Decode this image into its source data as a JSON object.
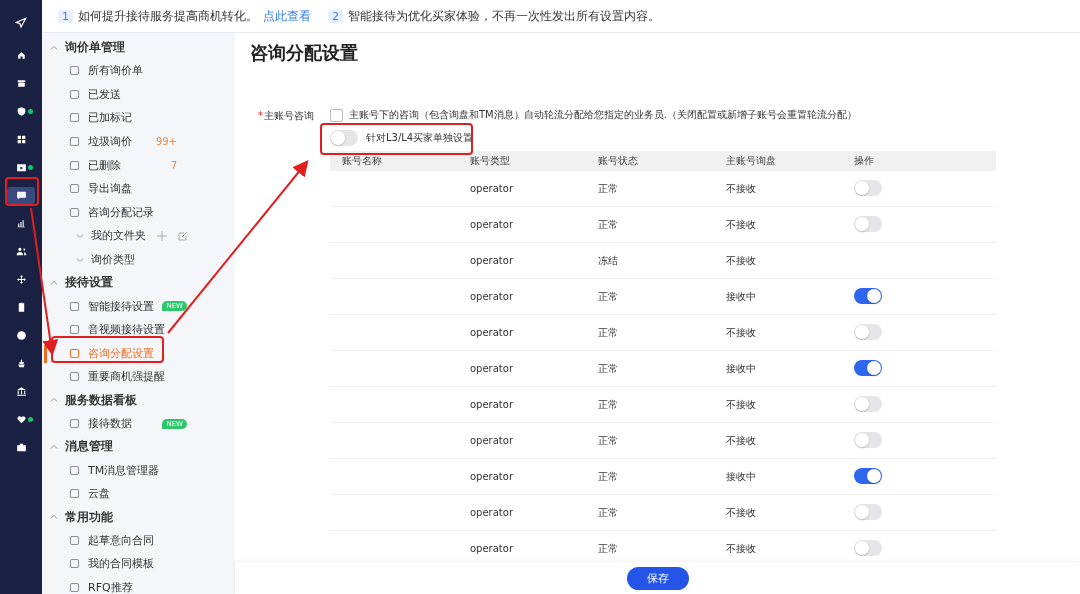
{
  "rail": [
    {
      "selected": false,
      "dot": false
    },
    {
      "selected": false,
      "dot": false
    },
    {
      "selected": false,
      "dot": true
    },
    {
      "selected": false,
      "dot": false
    },
    {
      "selected": false,
      "dot": true
    },
    {
      "selected": true,
      "dot": false
    },
    {
      "selected": false,
      "dot": false
    },
    {
      "selected": false,
      "dot": false
    },
    {
      "selected": false,
      "dot": false
    },
    {
      "selected": false,
      "dot": false
    },
    {
      "selected": false,
      "dot": false
    },
    {
      "selected": false,
      "dot": false
    },
    {
      "selected": false,
      "dot": false
    },
    {
      "selected": false,
      "dot": true
    },
    {
      "selected": false,
      "dot": false
    }
  ],
  "notices": [
    {
      "number": "1",
      "text": "如何提升接待服务提高商机转化。",
      "link": "点此查看"
    },
    {
      "number": "2",
      "text": "智能接待为优化买家体验，不再一次性发出所有设置内容。"
    }
  ],
  "sidebar": [
    {
      "title": "询价单管理",
      "expanded": true,
      "items": [
        {
          "kind": "item",
          "label": "所有询价单",
          "selected": false
        },
        {
          "kind": "item",
          "label": "已发送",
          "selected": false
        },
        {
          "kind": "item",
          "label": "已加标记",
          "selected": false
        },
        {
          "kind": "item",
          "label": "垃圾询价",
          "count": "99+",
          "selected": false
        },
        {
          "kind": "item",
          "label": "已删除",
          "count": "7",
          "selected": false
        },
        {
          "kind": "item",
          "label": "导出询盘",
          "selected": false
        },
        {
          "kind": "item",
          "label": "咨询分配记录",
          "selected": false
        },
        {
          "kind": "folder",
          "label": "我的文件夹",
          "actions": true,
          "selected": false
        },
        {
          "kind": "folder",
          "label": "询价类型",
          "selected": false
        }
      ]
    },
    {
      "title": "接待设置",
      "expanded": true,
      "items": [
        {
          "kind": "item",
          "label": "智能接待设置",
          "tag": "NEW",
          "selected": false
        },
        {
          "kind": "item",
          "label": "音视频接待设置",
          "selected": false
        },
        {
          "kind": "item",
          "label": "咨询分配设置",
          "selected": true
        },
        {
          "kind": "item",
          "label": "重要商机强提醒",
          "selected": false
        }
      ]
    },
    {
      "title": "服务数据看板",
      "expanded": true,
      "items": [
        {
          "kind": "item",
          "label": "接待数据",
          "tag": "NEW",
          "selected": false
        }
      ]
    },
    {
      "title": "消息管理",
      "expanded": true,
      "items": [
        {
          "kind": "item",
          "label": "TM消息管理器",
          "selected": false
        },
        {
          "kind": "item",
          "label": "云盘",
          "selected": false
        }
      ]
    },
    {
      "title": "常用功能",
      "expanded": true,
      "items": [
        {
          "kind": "item",
          "label": "起草意向合同",
          "selected": false
        },
        {
          "kind": "item",
          "label": "我的合同模板",
          "selected": false
        },
        {
          "kind": "item",
          "label": "RFQ推荐",
          "selected": false
        }
      ]
    }
  ],
  "page_title": "咨询分配设置",
  "form": {
    "label": "主账号咨询",
    "required_mark": "*",
    "checkbox": {
      "label": "主账号下的咨询（包含询盘和TM消息）自动轮流分配给您指定的业务员.（关闭配置或新增子账号会重置轮流分配）",
      "checked": false
    },
    "switch": {
      "label": "针对L3/L4买家单独设置",
      "on": false
    }
  },
  "table": {
    "columns": [
      "账号名称",
      "账号类型",
      "账号状态",
      "主账号询盘",
      "操作"
    ],
    "rows": [
      {
        "type": "operator",
        "status": "正常",
        "inquiry": "不接收",
        "on": false
      },
      {
        "type": "operator",
        "status": "正常",
        "inquiry": "不接收",
        "on": false
      },
      {
        "type": "operator",
        "status": "冻结",
        "inquiry": "不接收"
      },
      {
        "type": "operator",
        "status": "正常",
        "inquiry": "接收中",
        "on": true
      },
      {
        "type": "operator",
        "status": "正常",
        "inquiry": "不接收",
        "on": false
      },
      {
        "type": "operator",
        "status": "正常",
        "inquiry": "接收中",
        "on": true
      },
      {
        "type": "operator",
        "status": "正常",
        "inquiry": "不接收",
        "on": false
      },
      {
        "type": "operator",
        "status": "正常",
        "inquiry": "不接收",
        "on": false
      },
      {
        "type": "operator",
        "status": "正常",
        "inquiry": "接收中",
        "on": true
      },
      {
        "type": "operator",
        "status": "正常",
        "inquiry": "不接收",
        "on": false
      },
      {
        "type": "operator",
        "status": "正常",
        "inquiry": "不接收",
        "on": false
      }
    ]
  },
  "save_button": "保存"
}
